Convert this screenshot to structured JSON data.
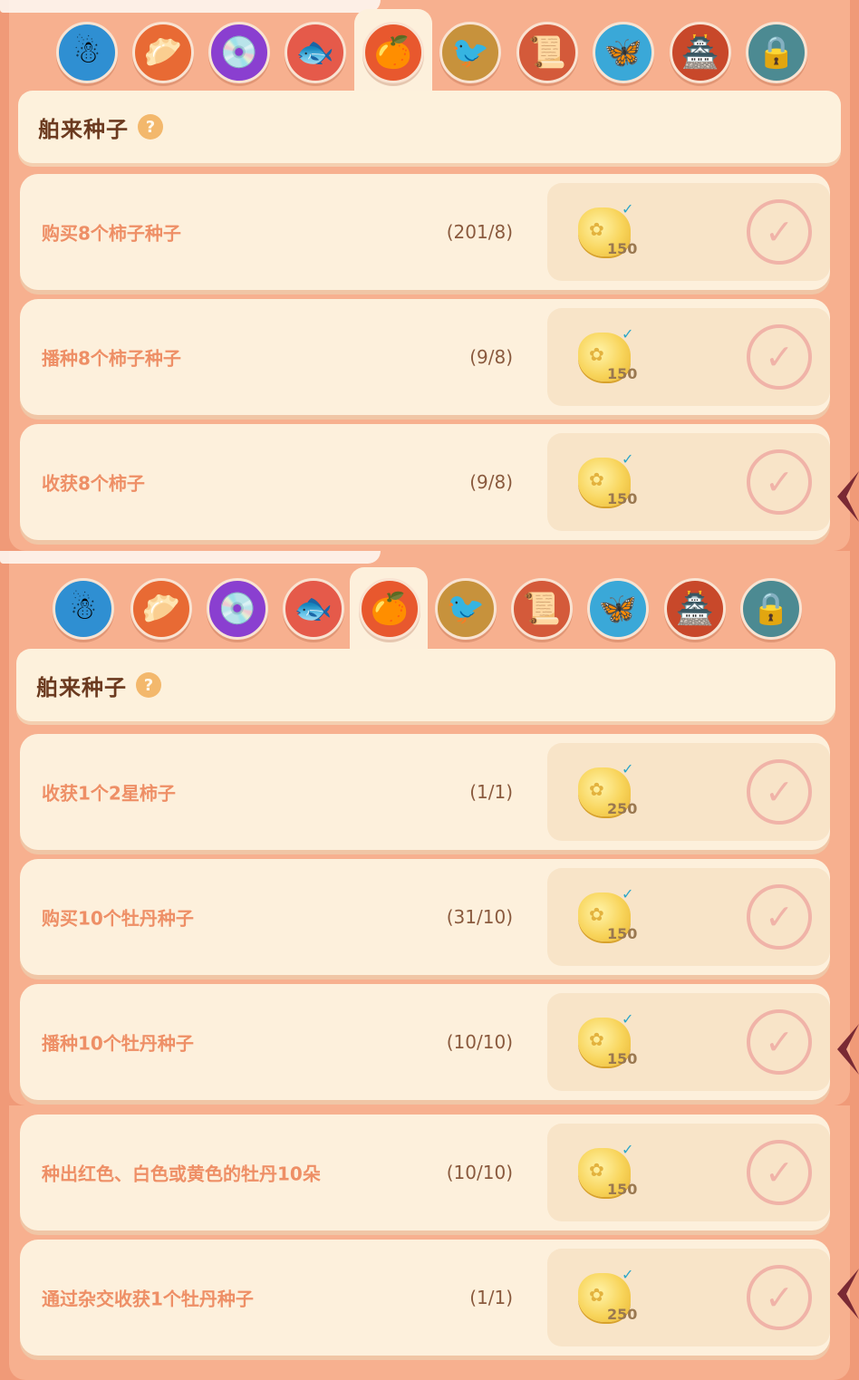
{
  "tabs_icons": [
    "snowman-icon",
    "dumplings-icon",
    "music-disc-icon",
    "fish-icon",
    "persimmon-icon",
    "bird-icon",
    "scroll-book-icon",
    "butterfly-icon",
    "pagoda-icon",
    "lock-icon"
  ],
  "tab_glyphs": [
    "☃",
    "🥟",
    "💿",
    "🐟",
    "🍊",
    "🐦",
    "📜",
    "🦋",
    "🏯",
    "🔒"
  ],
  "tab_colors": [
    "#2f8fd2",
    "#e86a34",
    "#8a3fd0",
    "#e55a4a",
    "#e8582e",
    "#c7923c",
    "#d45a3a",
    "#3aa8d8",
    "#c8482a",
    "#4c8a92"
  ],
  "screens": [
    {
      "title": "舶来种子",
      "help": "?",
      "tasks": [
        {
          "label": "购买8个柿子种子",
          "progress": "(201/8)",
          "reward": "150"
        },
        {
          "label": "播种8个柿子种子",
          "progress": "(9/8)",
          "reward": "150"
        },
        {
          "label": "收获8个柿子",
          "progress": "(9/8)",
          "reward": "150"
        }
      ]
    },
    {
      "title": "舶来种子",
      "help": "?",
      "tasks": [
        {
          "label": "收获1个2星柿子",
          "progress": "(1/1)",
          "reward": "250"
        },
        {
          "label": "购买10个牡丹种子",
          "progress": "(31/10)",
          "reward": "150"
        },
        {
          "label": "播种10个牡丹种子",
          "progress": "(10/10)",
          "reward": "150"
        }
      ]
    },
    {
      "tasks": [
        {
          "label": "种出红色、白色或黄色的牡丹10朵",
          "progress": "(10/10)",
          "reward": "150"
        },
        {
          "label": "通过杂交收获1个牡丹种子",
          "progress": "(1/1)",
          "reward": "250"
        }
      ]
    }
  ],
  "check_glyph": "✓",
  "coin_glyph": "✿",
  "coin_tick": "✓"
}
